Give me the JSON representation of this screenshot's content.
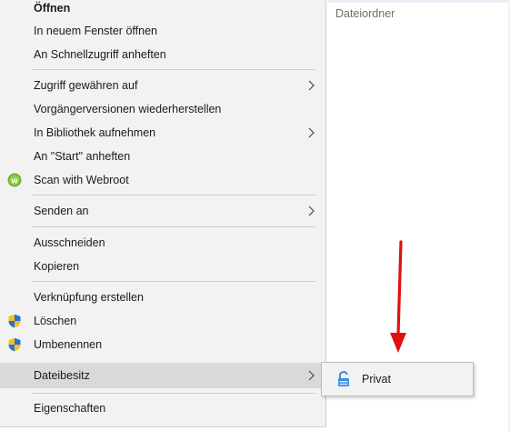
{
  "background": {
    "column_header": "Dateiordner"
  },
  "context_menu": {
    "items": [
      {
        "label": "Öffnen"
      },
      {
        "label": "In neuem Fenster öffnen"
      },
      {
        "label": "An Schnellzugriff anheften"
      },
      {
        "label": "Zugriff gewähren auf"
      },
      {
        "label": "Vorgängerversionen wiederherstellen"
      },
      {
        "label": "In Bibliothek aufnehmen"
      },
      {
        "label": "An \"Start\" anheften"
      },
      {
        "label": "Scan with Webroot"
      },
      {
        "label": "Senden an"
      },
      {
        "label": "Ausschneiden"
      },
      {
        "label": "Kopieren"
      },
      {
        "label": "Verknüpfung erstellen"
      },
      {
        "label": "Löschen"
      },
      {
        "label": "Umbenennen"
      },
      {
        "label": "Dateibesitz"
      },
      {
        "label": "Eigenschaften"
      }
    ]
  },
  "submenu": {
    "items": [
      {
        "label": "Privat"
      }
    ]
  },
  "colors": {
    "menu_bg": "#f2f2f2",
    "hover_bg": "#d9d9d9",
    "annotation_arrow": "#e01010"
  }
}
